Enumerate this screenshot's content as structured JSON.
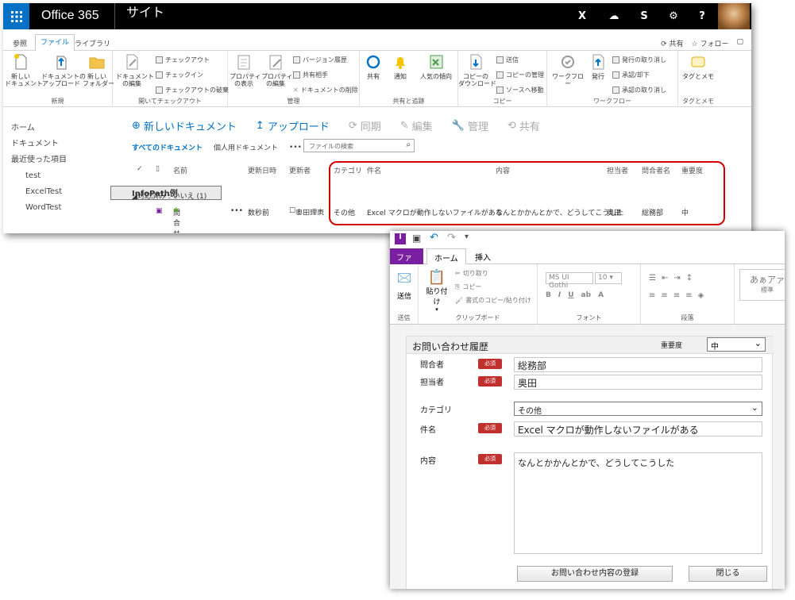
{
  "suite": {
    "app_name": "Office 365",
    "site_name": "サイト"
  },
  "ribbon_tabs": [
    "参照",
    "ファイル",
    "ライブラリ"
  ],
  "ribbon_right": {
    "share": "共有",
    "follow": "フォロー"
  },
  "ribbon": {
    "new_group": {
      "label": "新規",
      "new_doc": "新しい\nドキュメント",
      "upload": "ドキュメントの\nアップロード",
      "new_folder": "新しい\nフォルダー"
    },
    "checkout_group": {
      "label": "開いてチェックアウト",
      "edit": "ドキュメント\nの編集",
      "checkout": "チェックアウト",
      "checkin": "チェックイン",
      "discard": "チェックアウトの破棄"
    },
    "manage_group": {
      "label": "管理",
      "view_props": "プロパティ\nの表示",
      "edit_props": "プロパティ\nの編集",
      "version_history": "バージョン履歴",
      "shared_with": "共有相手",
      "delete": "ドキュメントの削除"
    },
    "share_group": {
      "label": "共有と追跡",
      "share": "共有",
      "alert": "通知",
      "popularity": "人気の傾向"
    },
    "copy_group": {
      "label": "コピー",
      "download": "コピーの\nダウンロード",
      "send": "送信",
      "manage_copies": "コピーの管理",
      "goto_source": "ソースへ移動"
    },
    "workflow_group": {
      "label": "ワークフロー",
      "workflow": "ワークフロー",
      "publish": "発行",
      "unpublish": "発行の取り消し",
      "approve": "承認/却下",
      "cancel_approval": "承認の取り消し"
    },
    "tags_group": {
      "label": "タグとメモ",
      "tags": "タグとメモ"
    }
  },
  "leftnav": [
    "ホーム",
    "ドキュメント",
    "最近使った項目",
    "test",
    "InfoPath例",
    "ExcelTest",
    "WordTest"
  ],
  "commands": {
    "new_doc": "新しいドキュメント",
    "upload": "アップロード",
    "sync": "同期",
    "edit": "編集",
    "manage": "管理",
    "share": "共有"
  },
  "views": {
    "all": "すべてのドキュメント",
    "personal": "個人用ドキュメント",
    "more": "•••",
    "search_placeholder": "ファイルの検索"
  },
  "columns": {
    "name": "名前",
    "modified": "更新日時",
    "modified_by": "更新者",
    "category": "カテゴリ",
    "subject": "件名",
    "content": "内容",
    "assignee": "担当者",
    "inquirer": "問合者名",
    "priority": "重要度"
  },
  "group_header": "対応済み : いいえ (1)",
  "row": {
    "name": "問合せ1",
    "dots": "•••",
    "modified": "数秒前",
    "modified_by": "奥田理恵",
    "category": "その他",
    "subject": "Excel マクロが動作しないファイルがある",
    "content": "なんとかかんとかで、どうしてこうした",
    "assignee": "奥田",
    "inquirer": "総務部",
    "priority": "中"
  },
  "form": {
    "tabs": {
      "file": "ファイル",
      "home": "ホーム",
      "insert": "挿入"
    },
    "ribbon": {
      "send": "送信",
      "send_group": "送信",
      "paste": "貼り付け",
      "cut": "切り取り",
      "copy": "コピー",
      "format_painter": "書式のコピー/貼り付け",
      "clipboard": "クリップボード",
      "font_name": "MS UI Gothi",
      "font_size": "10",
      "font_group": "フォント",
      "para_group": "段落",
      "style_sample": "あぁアァ",
      "style_name": "標準"
    },
    "title": "お問い合わせ履歴",
    "priority_label": "重要度",
    "priority_value": "中",
    "required": "必須",
    "fields": {
      "inquirer_label": "問合者",
      "inquirer_value": "総務部",
      "assignee_label": "担当者",
      "assignee_value": "奥田",
      "category_label": "カテゴリ",
      "category_value": "その他",
      "subject_label": "件名",
      "subject_value": "Excel マクロが動作しないファイルがある",
      "content_label": "内容",
      "content_value": "なんとかかんとかで、どうしてこうした"
    },
    "submit": "お問い合わせ内容の登録",
    "close": "閉じる"
  },
  "colors": {
    "suite_bar": "#000000",
    "waffle": "#0072c6",
    "accent": "#0072c6",
    "required_badge": "#c0312e",
    "highlight_box": "#d20000",
    "infopath_file_tab": "#7b1fa2"
  }
}
